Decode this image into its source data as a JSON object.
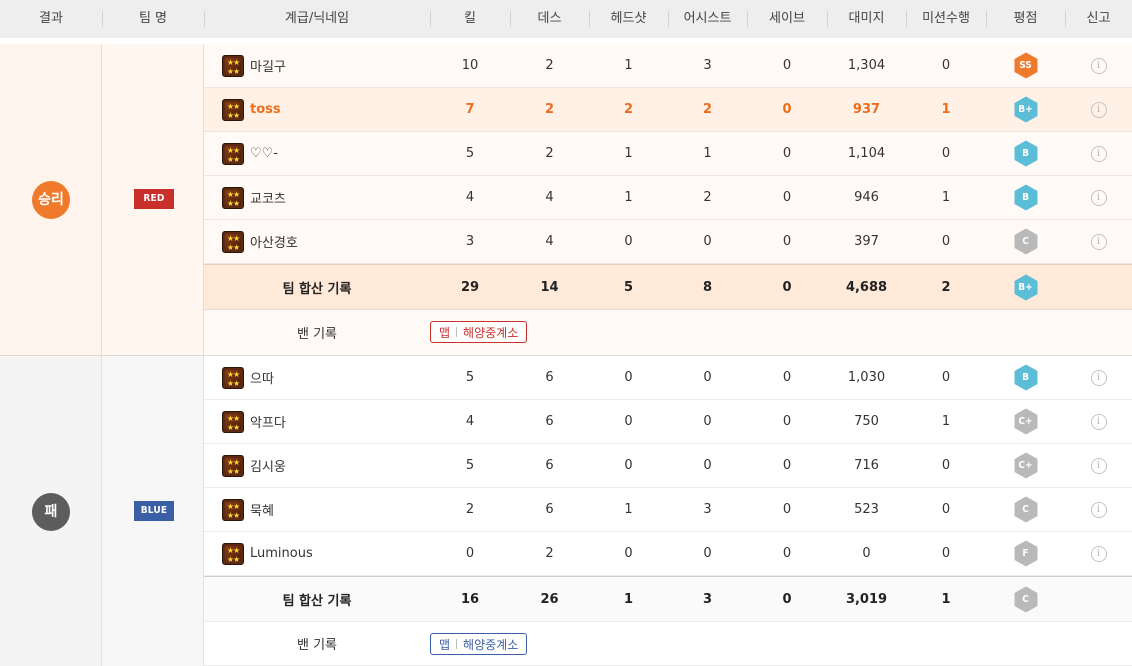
{
  "header": {
    "result": "결과",
    "team_name": "팀 명",
    "rank_nick": "계급/닉네임",
    "kill": "킬",
    "death": "데스",
    "headshot": "헤드샷",
    "assist": "어시스트",
    "save": "세이브",
    "damage": "대미지",
    "mission": "미션수행",
    "grade": "평점",
    "report": "신고"
  },
  "teams": [
    {
      "result": "승리",
      "tag": "RED",
      "players": [
        {
          "nick": "마길구",
          "kill": "10",
          "death": "2",
          "headshot": "1",
          "assist": "3",
          "save": "0",
          "damage": "1,304",
          "mission": "0",
          "grade": "SS"
        },
        {
          "nick": "toss",
          "kill": "7",
          "death": "2",
          "headshot": "2",
          "assist": "2",
          "save": "0",
          "damage": "937",
          "mission": "1",
          "grade": "B+"
        },
        {
          "nick": "♡♡-",
          "kill": "5",
          "death": "2",
          "headshot": "1",
          "assist": "1",
          "save": "0",
          "damage": "1,104",
          "mission": "0",
          "grade": "B"
        },
        {
          "nick": "교코츠",
          "kill": "4",
          "death": "4",
          "headshot": "1",
          "assist": "2",
          "save": "0",
          "damage": "946",
          "mission": "1",
          "grade": "B"
        },
        {
          "nick": "아산경호",
          "kill": "3",
          "death": "4",
          "headshot": "0",
          "assist": "0",
          "save": "0",
          "damage": "397",
          "mission": "0",
          "grade": "C"
        }
      ],
      "total": {
        "label": "팀 합산 기록",
        "kill": "29",
        "death": "14",
        "headshot": "5",
        "assist": "8",
        "save": "0",
        "damage": "4,688",
        "mission": "2",
        "grade": "B+"
      },
      "ban": {
        "label": "밴 기록",
        "map": "맵",
        "map_name": "해양중계소"
      }
    },
    {
      "result": "패",
      "tag": "BLUE",
      "players": [
        {
          "nick": "으따",
          "kill": "5",
          "death": "6",
          "headshot": "0",
          "assist": "0",
          "save": "0",
          "damage": "1,030",
          "mission": "0",
          "grade": "B"
        },
        {
          "nick": "악프다",
          "kill": "4",
          "death": "6",
          "headshot": "0",
          "assist": "0",
          "save": "0",
          "damage": "750",
          "mission": "1",
          "grade": "C+"
        },
        {
          "nick": "김시웅",
          "kill": "5",
          "death": "6",
          "headshot": "0",
          "assist": "0",
          "save": "0",
          "damage": "716",
          "mission": "0",
          "grade": "C+"
        },
        {
          "nick": "묵혜",
          "kill": "2",
          "death": "6",
          "headshot": "1",
          "assist": "3",
          "save": "0",
          "damage": "523",
          "mission": "0",
          "grade": "C"
        },
        {
          "nick": "Luminous",
          "kill": "0",
          "death": "2",
          "headshot": "0",
          "assist": "0",
          "save": "0",
          "damage": "0",
          "mission": "0",
          "grade": "F"
        }
      ],
      "total": {
        "label": "팀 합산 기록",
        "kill": "16",
        "death": "26",
        "headshot": "1",
        "assist": "3",
        "save": "0",
        "damage": "3,019",
        "mission": "1",
        "grade": "C"
      },
      "ban": {
        "label": "밴 기록",
        "map": "맵",
        "map_name": "해양중계소"
      }
    }
  ],
  "grade_colors": {
    "SS": "#f07a2c",
    "B+": "#5bbdd6",
    "B": "#5bbdd6",
    "C+": "#b9b9b9",
    "C": "#b9b9b9",
    "F": "#b9b9b9"
  },
  "icons": {
    "rank": "rank-stars-icon",
    "info": "info-icon"
  }
}
